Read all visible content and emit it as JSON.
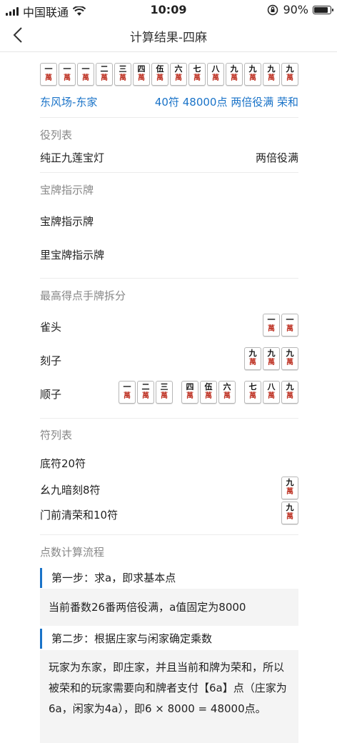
{
  "status": {
    "carrier": "中国联通",
    "time": "10:09",
    "battery": "90%",
    "battery_level": 0.9
  },
  "nav": {
    "title": "计算结果-四麻",
    "back_icon": "chevron-left-icon"
  },
  "hand": {
    "tiles": [
      {
        "num": "一",
        "suit": "萬"
      },
      {
        "num": "一",
        "suit": "萬"
      },
      {
        "num": "一",
        "suit": "萬"
      },
      {
        "num": "二",
        "suit": "萬"
      },
      {
        "num": "三",
        "suit": "萬"
      },
      {
        "num": "四",
        "suit": "萬"
      },
      {
        "num": "伍",
        "suit": "萬"
      },
      {
        "num": "六",
        "suit": "萬"
      },
      {
        "num": "七",
        "suit": "萬"
      },
      {
        "num": "八",
        "suit": "萬"
      },
      {
        "num": "九",
        "suit": "萬"
      },
      {
        "num": "九",
        "suit": "萬"
      },
      {
        "num": "九",
        "suit": "萬"
      },
      {
        "num": "九",
        "suit": "萬"
      }
    ],
    "wind": "东风场-东家",
    "result": "40符 48000点 两倍役满 荣和"
  },
  "yaku": {
    "title": "役列表",
    "items": [
      {
        "name": "纯正九莲宝灯",
        "value": "两倍役满"
      }
    ]
  },
  "dora": {
    "title": "宝牌指示牌",
    "items": [
      "宝牌指示牌",
      "里宝牌指示牌"
    ]
  },
  "split": {
    "title": "最高得点手牌拆分",
    "pair": {
      "label": "雀头",
      "tiles": [
        {
          "num": "一",
          "suit": "萬"
        },
        {
          "num": "一",
          "suit": "萬"
        }
      ]
    },
    "triplet": {
      "label": "刻子",
      "tiles": [
        {
          "num": "九",
          "suit": "萬"
        },
        {
          "num": "九",
          "suit": "萬"
        },
        {
          "num": "九",
          "suit": "萬"
        }
      ]
    },
    "sequence": {
      "label": "顺子",
      "groups": [
        [
          {
            "num": "一",
            "suit": "萬"
          },
          {
            "num": "二",
            "suit": "萬"
          },
          {
            "num": "三",
            "suit": "萬"
          }
        ],
        [
          {
            "num": "四",
            "suit": "萬"
          },
          {
            "num": "伍",
            "suit": "萬"
          },
          {
            "num": "六",
            "suit": "萬"
          }
        ],
        [
          {
            "num": "七",
            "suit": "萬"
          },
          {
            "num": "八",
            "suit": "萬"
          },
          {
            "num": "九",
            "suit": "萬"
          }
        ]
      ]
    }
  },
  "fu": {
    "title": "符列表",
    "items": [
      {
        "label": "底符20符"
      },
      {
        "label": "幺九暗刻8符",
        "tile": {
          "num": "九",
          "suit": "萬"
        }
      },
      {
        "label": "门前清荣和10符",
        "tile": {
          "num": "九",
          "suit": "萬"
        }
      }
    ]
  },
  "calc": {
    "title": "点数计算流程",
    "step1": {
      "heading": "第一步：求a，即求基本点",
      "body": "当前番数26番两倍役满，a值固定为8000"
    },
    "step2": {
      "heading": "第二步：根据庄家与闲家确定乘数",
      "body": "玩家为东家，即庄家，并且当前和牌为荣和，所以被荣和的玩家需要向和牌者支付【6a】点（庄家为6a，闲家为4a），即6 × 8000 = 48000点。"
    }
  },
  "colors": {
    "accent": "#1a73c8",
    "tile_suit": "#c0392b"
  }
}
